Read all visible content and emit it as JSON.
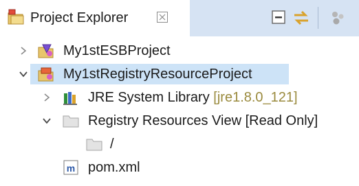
{
  "tab": {
    "title": "Project Explorer",
    "close_symbol": "⌧"
  },
  "toolbar": {
    "collapse_all_icon": "collapse-all-icon",
    "link_editor_icon": "link-with-editor-icon",
    "view_menu_icon": "view-menu-icon"
  },
  "tree": {
    "items": [
      {
        "label": "My1stESBProject",
        "expanded": false,
        "icon": "esb-project-icon"
      },
      {
        "label": "My1stRegistryResourceProject",
        "expanded": true,
        "selected": true,
        "icon": "registry-project-icon"
      },
      {
        "label": "JRE System Library",
        "decoration": "[jre1.8.0_121]",
        "expanded": false,
        "icon": "library-icon"
      },
      {
        "label": "Registry Resources View [Read Only]",
        "expanded": true,
        "icon": "folder-icon"
      },
      {
        "label": "/",
        "icon": "folder-icon"
      },
      {
        "label": "pom.xml",
        "icon": "maven-file-icon"
      }
    ]
  },
  "colors": {
    "selection": "#cde3f7",
    "toolbar_bg": "#d6e3f3",
    "decoration": "#9a8a3d"
  }
}
